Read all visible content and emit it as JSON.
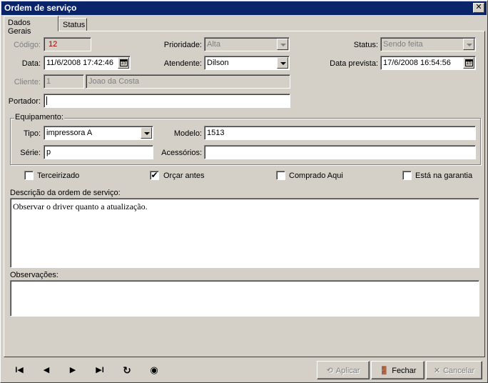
{
  "window": {
    "title": "Ordem de serviço",
    "close_glyph": "✕"
  },
  "tabs": [
    {
      "label": "Dados Gerais"
    },
    {
      "label": "Status"
    }
  ],
  "form": {
    "codigo_label": "Código:",
    "codigo_value": "12",
    "prioridade_label": "Prioridade:",
    "prioridade_value": "Alta",
    "status_label": "Status:",
    "status_value": "Sendo feita",
    "data_label": "Data:",
    "data_value": "11/6/2008 17:42:46",
    "atendente_label": "Atendente:",
    "atendente_value": "Dilson",
    "data_prevista_label": "Data prevista:",
    "data_prevista_value": "17/6/2008 16:54:56",
    "cliente_label": "Cliente:",
    "cliente_id": "1",
    "cliente_nome": "Joao da Costa",
    "portador_label": "Portador:",
    "portador_value": ""
  },
  "equipamento": {
    "group_label": "Equipamento:",
    "tipo_label": "Tipo:",
    "tipo_value": "impressora A",
    "modelo_label": "Modelo:",
    "modelo_value": "1513",
    "serie_label": "Série:",
    "serie_value": "p",
    "acessorios_label": "Acessórios:",
    "acessorios_value": ""
  },
  "checkboxes": [
    {
      "label": "Terceirizado",
      "checked": false,
      "mark": ""
    },
    {
      "label": "Orçar antes",
      "checked": true,
      "mark": "✔"
    },
    {
      "label": "Comprado Aqui",
      "checked": false,
      "mark": ""
    },
    {
      "label": "Está na garantia",
      "checked": false,
      "mark": ""
    }
  ],
  "descricao": {
    "label": "Descrição da ordem de serviço:",
    "value": "Observar o driver quanto a atualização."
  },
  "observacoes": {
    "label": "Observações:",
    "value": ""
  },
  "nav": {
    "first_icon": "first-record-icon",
    "first_glyph": "I◀",
    "prev_icon": "prev-record-icon",
    "prev_glyph": "◀",
    "next_icon": "next-record-icon",
    "next_glyph": "▶",
    "last_icon": "last-record-icon",
    "last_glyph": "▶I",
    "refresh_icon": "refresh-icon",
    "refresh_glyph": "↻",
    "record_icon": "record-icon",
    "record_glyph": "◉"
  },
  "buttons": {
    "aplicar": "Aplicar",
    "aplicar_glyph": "⟲",
    "fechar": "Fechar",
    "fechar_glyph": "🚪",
    "cancelar": "Cancelar",
    "cancelar_glyph": "✕"
  },
  "colors": {
    "title_bar": "#0a246a",
    "face": "#d4d0c8",
    "codigo_text": "#a00000"
  }
}
